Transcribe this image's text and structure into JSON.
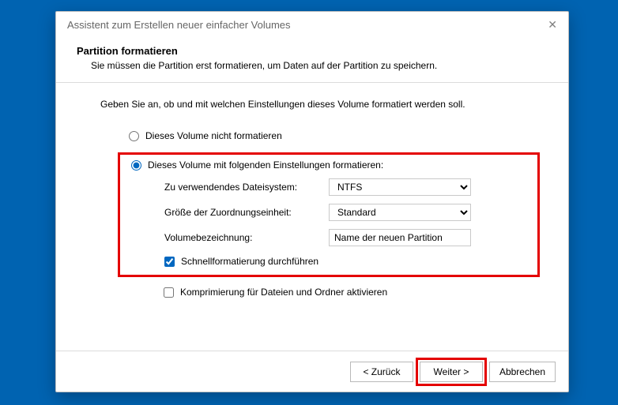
{
  "title": "Assistent zum Erstellen neuer einfacher Volumes",
  "header": {
    "heading": "Partition formatieren",
    "subheading": "Sie müssen die Partition erst formatieren, um Daten auf der Partition zu speichern."
  },
  "intro": "Geben Sie an, ob und mit welchen Einstellungen dieses Volume formatiert werden soll.",
  "radios": {
    "noformat": "Dieses Volume nicht formatieren",
    "format": "Dieses Volume mit folgenden Einstellungen formatieren:"
  },
  "fields": {
    "fs_label": "Zu verwendendes Dateisystem:",
    "fs_value": "NTFS",
    "alloc_label": "Größe der Zuordnungseinheit:",
    "alloc_value": "Standard",
    "vol_label": "Volumebezeichnung:",
    "vol_value": "Name der neuen Partition"
  },
  "checks": {
    "quick": "Schnellformatierung durchführen",
    "compress": "Komprimierung für Dateien und Ordner aktivieren"
  },
  "buttons": {
    "back": "< Zurück",
    "next": "Weiter >",
    "cancel": "Abbrechen"
  }
}
